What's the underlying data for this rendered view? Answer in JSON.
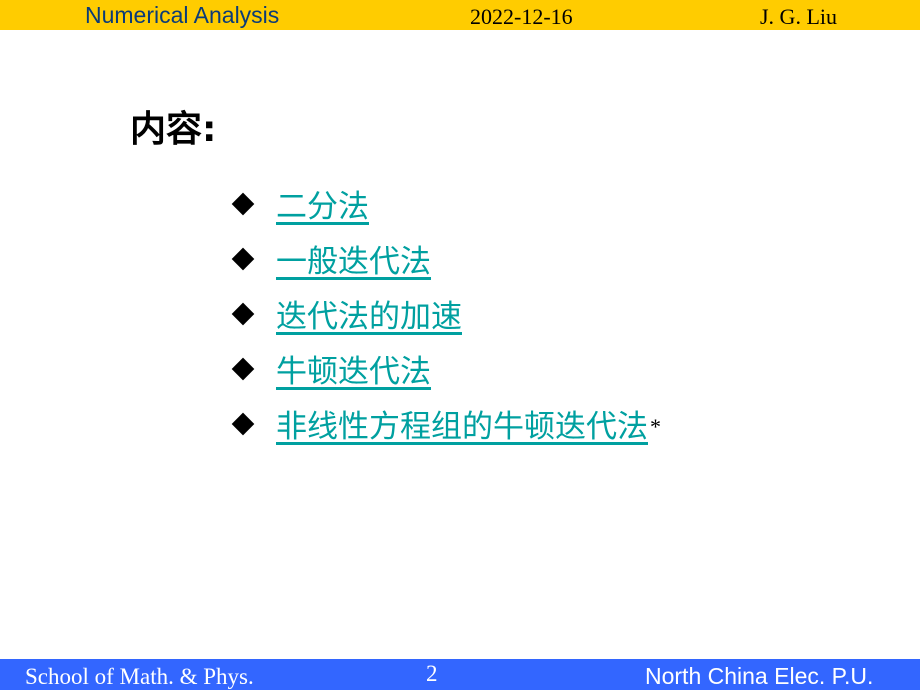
{
  "header": {
    "title": "Numerical Analysis",
    "date": "2022-12-16",
    "author": "J. G. Liu",
    "background": "#FFCC00"
  },
  "content": {
    "title": "内容:",
    "items": [
      {
        "label": "二分法"
      },
      {
        "label": "一般迭代法"
      },
      {
        "label": "迭代法的加速"
      },
      {
        "label": "牛顿迭代法"
      },
      {
        "label": "非线性方程组的牛顿迭代法",
        "suffix": "*"
      }
    ],
    "link_color": "#00A0A0"
  },
  "footer": {
    "school": "School of Math. & Phys.",
    "page": "2",
    "university": "North China Elec. P.U.",
    "background": "#3366FF"
  }
}
